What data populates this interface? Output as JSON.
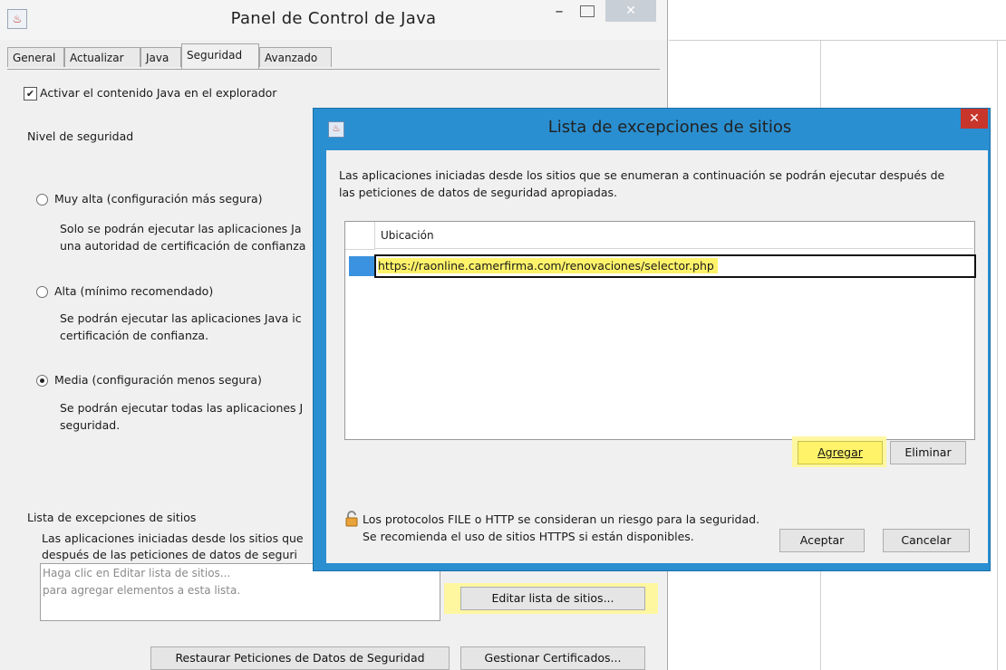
{
  "main_window": {
    "title": "Panel de Control de Java",
    "tabs": [
      "General",
      "Actualizar",
      "Java",
      "Seguridad",
      "Avanzado"
    ],
    "enable_java_label": "Activar el contenido Java en el explorador",
    "security_level_label": "Nivel de seguridad",
    "very_high": {
      "label": "Muy alta (configuración más segura)",
      "desc_line1": "Solo se podrán ejecutar las aplicaciones Ja",
      "desc_line2": "una autoridad de certificación de confianza"
    },
    "high": {
      "label": "Alta (mínimo recomendado)",
      "desc_line1": "Se podrán ejecutar las aplicaciones Java ic",
      "desc_line2": "certificación de confianza."
    },
    "medium": {
      "label": "Media (configuración menos segura)",
      "desc_line1": "Se podrán ejecutar todas las aplicaciones J",
      "desc_line2": "seguridad."
    },
    "exceptions_title": "Lista de excepciones de sitios",
    "exceptions_desc1": "Las aplicaciones iniciadas desde los sitios que",
    "exceptions_desc2": "después de las peticiones de datos de seguri",
    "exceptions_placeholder1": "Haga clic en Editar lista de sitios...",
    "exceptions_placeholder2": "para agregar elementos a esta lista.",
    "edit_sites_button": "Editar lista de sitios...",
    "restore_button": "Restaurar Peticiones de Datos de Seguridad",
    "manage_certs_button": "Gestionar Certificados..."
  },
  "dialog": {
    "title": "Lista de excepciones de sitios",
    "desc_line1": "Las aplicaciones iniciadas desde los sitios que se enumeran a continuación se podrán ejecutar después de",
    "desc_line2": "las peticiones de datos de seguridad apropiadas.",
    "column_header": "Ubicación",
    "rows": [
      "https://raonline.camerfirma.com/renovaciones/selector.php"
    ],
    "add_button": "Agregar",
    "remove_button": "Eliminar",
    "warning_line1": "Los protocolos FILE o HTTP se consideran un riesgo para la seguridad.",
    "warning_line2": "Se recomienda el uso de sitios HTTPS si están disponibles.",
    "ok_button": "Aceptar",
    "cancel_button": "Cancelar"
  },
  "icons": {
    "app": "java-icon",
    "lock": "lock-icon"
  },
  "colors": {
    "dialog_frame": "#2a8fd0",
    "highlight": "#fff36a",
    "close_red": "#c7352b"
  }
}
